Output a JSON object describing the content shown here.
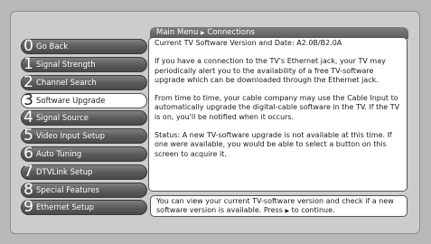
{
  "menu": {
    "items": [
      {
        "number": "0",
        "label": "Go Back"
      },
      {
        "number": "1",
        "label": "Signal Strength"
      },
      {
        "number": "2",
        "label": "Channel Search"
      },
      {
        "number": "3",
        "label": "Software Upgrade"
      },
      {
        "number": "4",
        "label": "Signal Source"
      },
      {
        "number": "5",
        "label": "Video Input Setup"
      },
      {
        "number": "6",
        "label": "Auto Tuning"
      },
      {
        "number": "7",
        "label": "DTVLink Setup"
      },
      {
        "number": "8",
        "label": "Special Features"
      },
      {
        "number": "9",
        "label": "Ethernet Setup"
      }
    ],
    "selected_index": 3
  },
  "breadcrumb": {
    "root": "Main Menu",
    "separator_icon": "right-triangle",
    "current": "Connections"
  },
  "content": {
    "title": "Current TV Software Version and Date: A2.0B/B2.0A",
    "para1": "If you have a connection to the TV's Ethernet jack, your TV may periodically alert you to the availability of a free TV-software upgrade which can be downloaded through the Ethernet jack.",
    "para2": "From time to time, your cable company may use the Cable Input to automatically upgrade the digital-cable software in the TV. If the TV is on, you'll be notified when it occurs.",
    "para3": "Status: A new TV-software upgrade is not available at this time. If one were available, you would be able to select a button on this screen to acquire it."
  },
  "footer": {
    "text_before": "You can view your current TV-software version and check if a new software version is available. Press",
    "arrow_icon": "right-triangle",
    "text_after": "to continue."
  }
}
